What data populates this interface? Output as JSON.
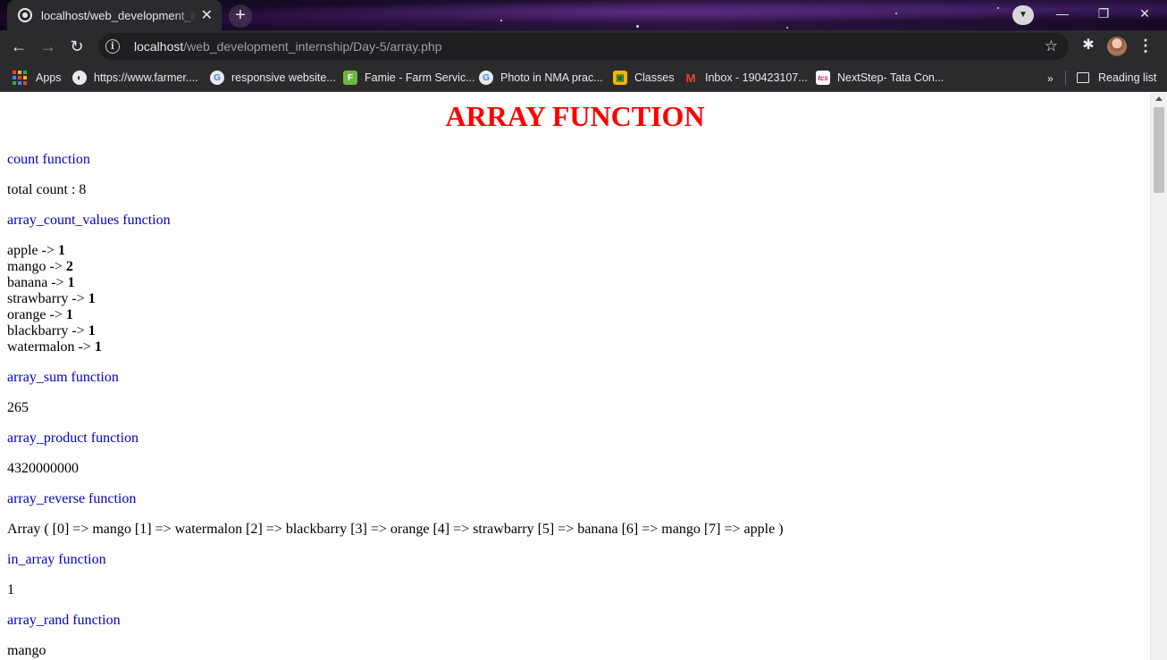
{
  "browser": {
    "tab": {
      "title": "localhost/web_development_internship/Day-5/array.php",
      "close": "✕"
    },
    "new_tab": "+",
    "window_controls": {
      "minimize": "—",
      "restore": "❐",
      "close": "✕"
    },
    "url": {
      "host": "localhost",
      "path": "/web_development_internship/Day-5/array.php"
    },
    "nav": {
      "back": "←",
      "forward": "→",
      "reload": "↻"
    },
    "bookmarks": [
      {
        "label": "Apps",
        "icon": "apps-grid-icon"
      },
      {
        "label": "https://www.farmer....",
        "icon": "globe-icon"
      },
      {
        "label": "responsive website...",
        "icon": "google-icon"
      },
      {
        "label": "Famie - Farm Servic...",
        "icon": "famie-icon"
      },
      {
        "label": "Photo in NMA prac...",
        "icon": "google-icon"
      },
      {
        "label": "Classes",
        "icon": "classroom-icon"
      },
      {
        "label": "Inbox - 190423107...",
        "icon": "gmail-icon"
      },
      {
        "label": "NextStep- Tata Con...",
        "icon": "tcs-icon"
      }
    ],
    "reading_list": "Reading list"
  },
  "page": {
    "title": "ARRAY FUNCTION",
    "sections": [
      {
        "heading": "count function",
        "output": "total count : 8"
      },
      {
        "heading": "array_count_values function",
        "items": [
          {
            "key": "apple",
            "value": "1"
          },
          {
            "key": "mango",
            "value": "2"
          },
          {
            "key": "banana",
            "value": "1"
          },
          {
            "key": "strawbarry",
            "value": "1"
          },
          {
            "key": "orange",
            "value": "1"
          },
          {
            "key": "blackbarry",
            "value": "1"
          },
          {
            "key": "watermalon",
            "value": "1"
          }
        ]
      },
      {
        "heading": "array_sum function",
        "output": "265"
      },
      {
        "heading": "array_product function",
        "output": "4320000000"
      },
      {
        "heading": "array_reverse function",
        "output": "Array ( [0] => mango [1] => watermalon [2] => blackbarry [3] => orange [4] => strawbarry [5] => banana [6] => mango [7] => apple )"
      },
      {
        "heading": "in_array function",
        "output": "1"
      },
      {
        "heading": "array_rand function",
        "output": "mango"
      }
    ]
  }
}
